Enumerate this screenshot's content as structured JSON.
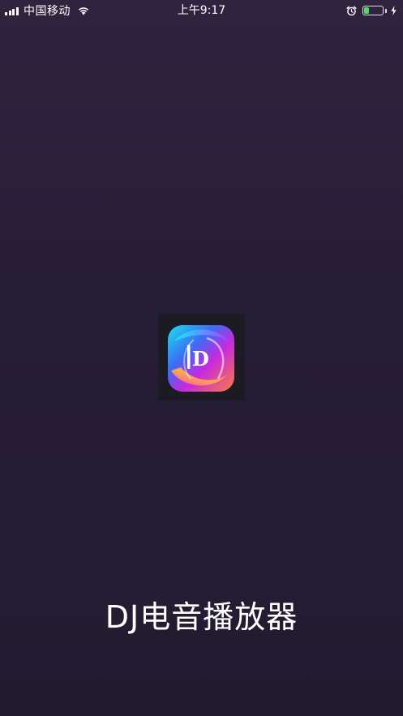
{
  "status_bar": {
    "carrier": "中国移动",
    "time": "上午9:17",
    "battery_level": 0.35,
    "icons": [
      "signal-icon",
      "wifi-icon",
      "alarm-icon",
      "battery-icon",
      "charging-icon"
    ]
  },
  "splash": {
    "logo_icon": "dj-logo-icon",
    "logo_letter": "D",
    "app_name": "DJ电音播放器"
  },
  "colors": {
    "background_top": "#30233f",
    "background_bottom": "#221b30",
    "battery_fill": "#4cd964",
    "text": "#ffffff"
  }
}
